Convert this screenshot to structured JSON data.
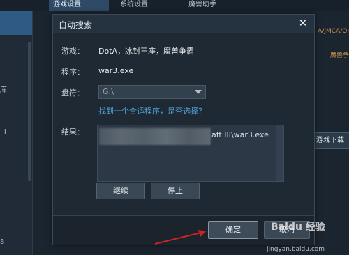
{
  "background": {
    "tabs": [
      {
        "label": "游戏设置",
        "active": true
      },
      {
        "label": "系统设置",
        "active": false
      },
      {
        "label": "魔兽助手",
        "active": false
      }
    ],
    "sidebar_items": [
      "库",
      "III",
      "8"
    ],
    "right_texts": [
      "A/JMCA/OI",
      "魔兽争",
      "游戏下载"
    ]
  },
  "dialog": {
    "title": "自动搜索",
    "close_icon": "close-icon",
    "game_label": "游戏：",
    "game_value": "DotA，冰封王座，魔兽争霸",
    "program_label": "程序：",
    "program_value": "war3.exe",
    "drive_label": "盘符：",
    "drive_value": "G:\\",
    "found_link": "找到一个合适程序，是否选择？",
    "result_label": "结果：",
    "result_text": "aft III\\war3.exe",
    "continue_button": "继续",
    "stop_button": "停止",
    "confirm_button": "确定",
    "cancel_button": "取消"
  },
  "colors": {
    "accent_link": "#4fa4dc",
    "annotation_red": "#d32020"
  },
  "watermark": {
    "text": "Baidu 经验",
    "url": "jingyan.baidu.com"
  }
}
